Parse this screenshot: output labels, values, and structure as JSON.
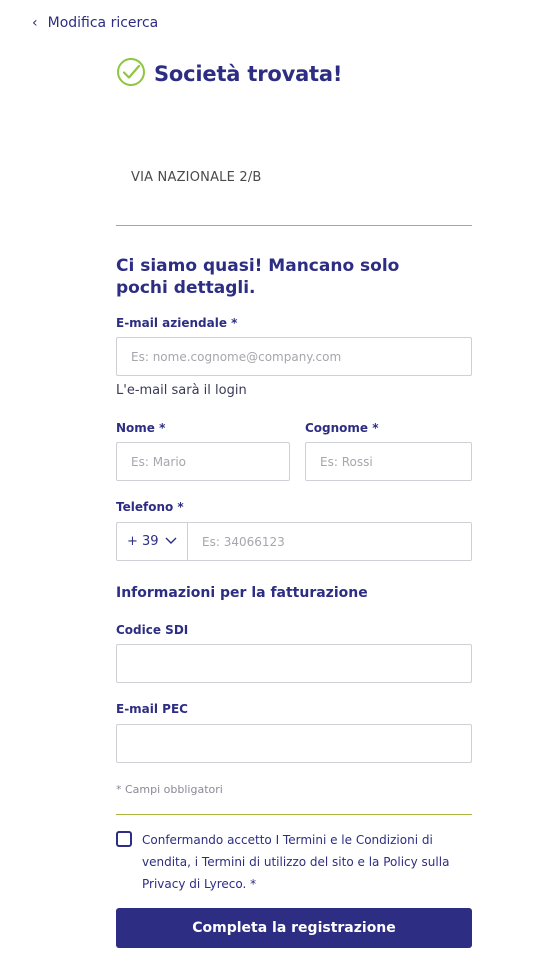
{
  "nav": {
    "back_label": "Modifica ricerca"
  },
  "result": {
    "title": "Società trovata!",
    "address": "VIA NAZIONALE 2/B"
  },
  "form": {
    "heading": "Ci siamo quasi! Mancano solo pochi dettagli.",
    "email": {
      "label": "E-mail aziendale *",
      "placeholder": "Es: nome.cognome@company.com",
      "hint": "L'e-mail sarà il login"
    },
    "first_name": {
      "label": "Nome *",
      "placeholder": "Es: Mario"
    },
    "last_name": {
      "label": "Cognome *",
      "placeholder": "Es: Rossi"
    },
    "phone": {
      "label": "Telefono *",
      "prefix": "+ 39",
      "placeholder": "Es: 34066123"
    },
    "billing_section": "Informazioni per la fatturazione",
    "sdi": {
      "label": "Codice SDI",
      "value": ""
    },
    "pec": {
      "label": "E-mail PEC",
      "value": ""
    },
    "required_note": "* Campi obbligatori",
    "terms": {
      "prefix": "Confermando accetto ",
      "link1": "I Termini e le Condizioni di vendita",
      "sep1": ", ",
      "link2": "i Termini di utilizzo del sito",
      "sep2": " e ",
      "link3": "la Policy sulla Privacy di Lyreco",
      "suffix": ". *"
    },
    "submit_label": "Completa la registrazione"
  },
  "colors": {
    "brand": "#2d2e83",
    "accent_green": "#8dc63f",
    "divider": "#a9b33d"
  }
}
